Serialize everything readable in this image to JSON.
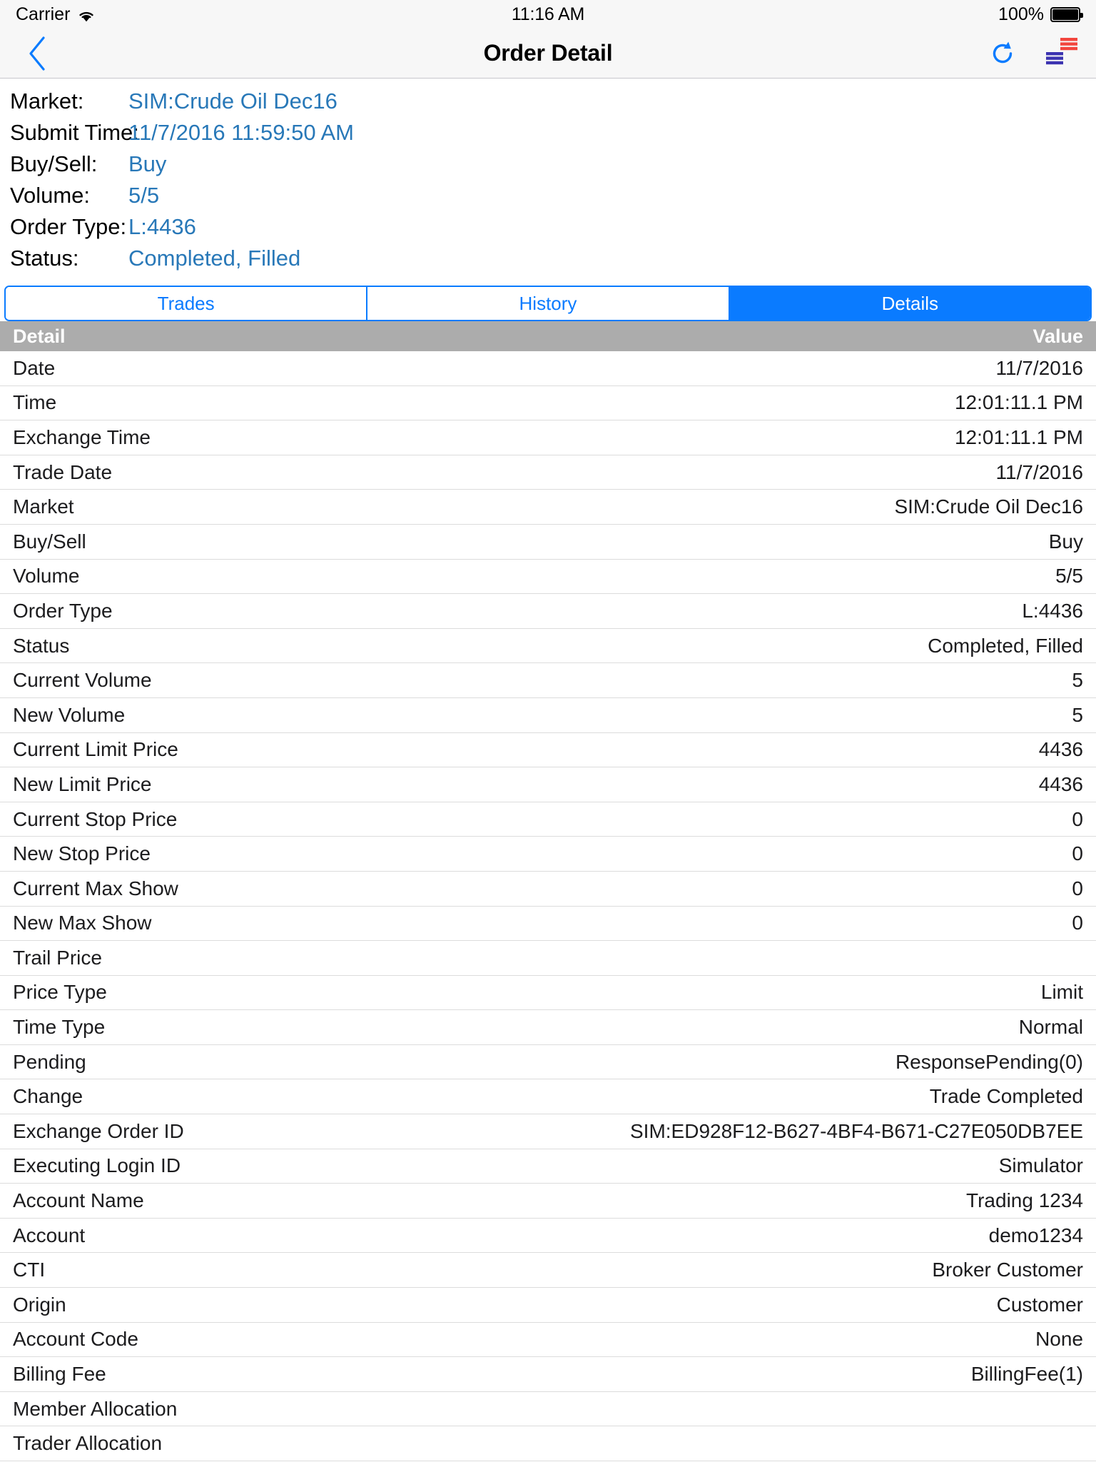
{
  "status_bar": {
    "carrier": "Carrier",
    "wifi_icon": "wifi-icon",
    "time": "11:16 AM",
    "battery_percent": "100%",
    "battery_icon": "battery-full-icon"
  },
  "nav_bar": {
    "back_icon": "chevron-left-icon",
    "title": "Order Detail",
    "refresh_icon": "refresh-icon",
    "depth_icon": "depth-of-market-icon",
    "accent_color": "#0a7bff"
  },
  "summary": {
    "value_color": "#2878b8",
    "rows": [
      {
        "label": "Market:",
        "value": "SIM:Crude Oil Dec16"
      },
      {
        "label": "Submit Time:",
        "value": "11/7/2016 11:59:50 AM"
      },
      {
        "label": "Buy/Sell:",
        "value": "Buy"
      },
      {
        "label": "Volume:",
        "value": "5/5"
      },
      {
        "label": "Order Type:",
        "value": "L:4436"
      },
      {
        "label": "Status:",
        "value": "Completed, Filled"
      }
    ]
  },
  "tabs": {
    "selected_index": 2,
    "items": [
      {
        "label": "Trades"
      },
      {
        "label": "History"
      },
      {
        "label": "Details"
      }
    ]
  },
  "table": {
    "header_background": "#acacac",
    "columns": [
      "Detail",
      "Value"
    ],
    "rows": [
      {
        "key": "Date",
        "value": "11/7/2016"
      },
      {
        "key": "Time",
        "value": "12:01:11.1 PM"
      },
      {
        "key": "Exchange Time",
        "value": "12:01:11.1 PM"
      },
      {
        "key": "Trade Date",
        "value": "11/7/2016"
      },
      {
        "key": "Market",
        "value": "SIM:Crude Oil Dec16"
      },
      {
        "key": "Buy/Sell",
        "value": "Buy"
      },
      {
        "key": "Volume",
        "value": "5/5"
      },
      {
        "key": "Order Type",
        "value": "L:4436"
      },
      {
        "key": "Status",
        "value": "Completed, Filled"
      },
      {
        "key": "Current Volume",
        "value": "5"
      },
      {
        "key": "New Volume",
        "value": "5"
      },
      {
        "key": "Current Limit Price",
        "value": "4436"
      },
      {
        "key": "New Limit Price",
        "value": "4436"
      },
      {
        "key": "Current Stop Price",
        "value": "0"
      },
      {
        "key": "New Stop Price",
        "value": "0"
      },
      {
        "key": "Current Max Show",
        "value": "0"
      },
      {
        "key": "New Max Show",
        "value": "0"
      },
      {
        "key": "Trail Price",
        "value": ""
      },
      {
        "key": "Price Type",
        "value": "Limit"
      },
      {
        "key": "Time Type",
        "value": "Normal"
      },
      {
        "key": "Pending",
        "value": "ResponsePending(0)"
      },
      {
        "key": "Change",
        "value": "Trade Completed"
      },
      {
        "key": "Exchange Order ID",
        "value": "SIM:ED928F12-B627-4BF4-B671-C27E050DB7EE"
      },
      {
        "key": "Executing Login ID",
        "value": "Simulator"
      },
      {
        "key": "Account Name",
        "value": "Trading 1234"
      },
      {
        "key": "Account",
        "value": "demo1234"
      },
      {
        "key": "CTI",
        "value": "Broker Customer"
      },
      {
        "key": "Origin",
        "value": "Customer"
      },
      {
        "key": "Account Code",
        "value": "None"
      },
      {
        "key": "Billing Fee",
        "value": "BillingFee(1)"
      },
      {
        "key": "Member Allocation",
        "value": ""
      },
      {
        "key": "Trader Allocation",
        "value": ""
      }
    ]
  }
}
